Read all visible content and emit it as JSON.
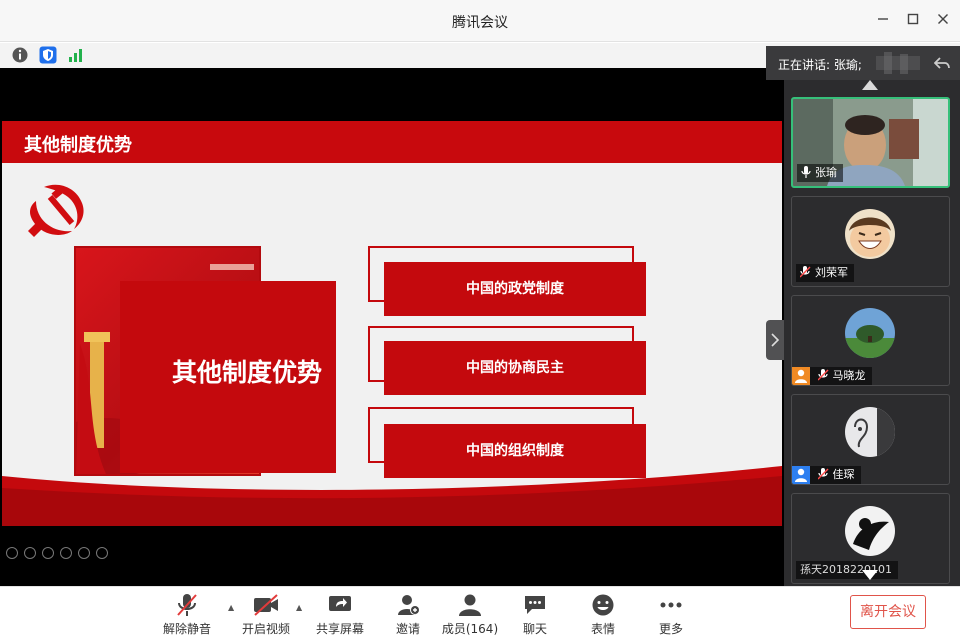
{
  "window": {
    "title": "腾讯会议"
  },
  "speaking": {
    "label": "正在讲话: 张瑜;"
  },
  "slide": {
    "header": "其他制度优势",
    "big_card_text": "其他制度优势",
    "items": [
      {
        "label": "中国的政党制度"
      },
      {
        "label": "中国的协商民主"
      },
      {
        "label": "中国的组织制度"
      }
    ]
  },
  "participants": [
    {
      "name": "张瑜",
      "mic": "on",
      "active": true
    },
    {
      "name": "刘荣军",
      "mic": "muted"
    },
    {
      "name": "马晓龙",
      "mic": "muted"
    },
    {
      "name": "佳琛",
      "mic": "muted"
    },
    {
      "name": "孫天2018220101",
      "mic": "none"
    }
  ],
  "toolbar": {
    "mute_label": "解除静音",
    "video_label": "开启视频",
    "share_label": "共享屏幕",
    "invite_label": "邀请",
    "members_label": "成员(164)",
    "chat_label": "聊天",
    "emoji_label": "表情",
    "more_label": "更多",
    "leave_label": "离开会议"
  },
  "colors": {
    "accent_red": "#c4090d",
    "leave_red": "#e0544a",
    "speaker_green": "#36c07a"
  }
}
